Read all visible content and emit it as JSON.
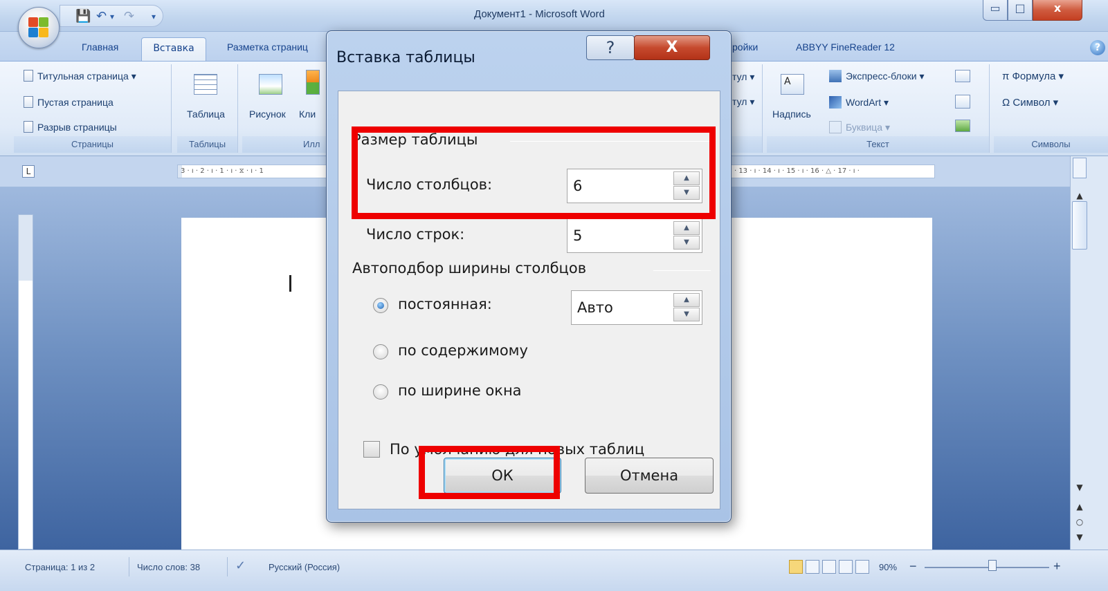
{
  "window": {
    "title": "Документ1 - Microsoft Word",
    "minimize_glyph": "▭",
    "maximize_glyph": "□",
    "close_glyph": "x"
  },
  "quick_access": {
    "save_icon": "💾",
    "undo_icon": "↶",
    "redo_icon": "↷",
    "customize_icon": "▾",
    "separator": "▾"
  },
  "tabs": [
    {
      "label": "Главная"
    },
    {
      "label": "Вставка"
    },
    {
      "label": "Разметка страниц"
    },
    {
      "label": "ройки"
    },
    {
      "label": "ABBYY FineReader 12"
    }
  ],
  "help_glyph": "?",
  "ribbon": {
    "pages_group": {
      "label": "Страницы",
      "items": [
        "Титульная страница ▾",
        "Пустая страница",
        "Разрыв страницы"
      ]
    },
    "tables_group": {
      "label": "Таблицы",
      "button": "Таблица"
    },
    "illustrations_group": {
      "label": "Илл",
      "button_picture": "Рисунок",
      "button_clip": "Кли"
    },
    "header_partial": {
      "item1": "тул ▾",
      "item2": "тул ▾"
    },
    "text_group": {
      "label": "Текст",
      "textbox": "Надпись",
      "items": [
        "Экспресс-блоки ▾",
        "WordArt ▾",
        "Буквица ▾"
      ]
    },
    "symbols_group": {
      "label": "Символы",
      "formula": "π Формула ▾",
      "symbol": "Ω Символ ▾"
    }
  },
  "ruler": {
    "corner": "L",
    "left_marks": "3 · ı · 2 · ı · 1 · ı · ⧖ · ı · 1",
    "right_marks": "ı · 13 · ı · 14 · ı · 15 · ı · 16 · △ · 17 · ı ·"
  },
  "dialog": {
    "title": "Вставка таблицы",
    "help_label": "?",
    "close_label": "X",
    "size_section": "Размер таблицы",
    "columns_label": "Число столбцов:",
    "columns_value": "6",
    "rows_label": "Число строк:",
    "rows_value": "5",
    "autofit_section": "Автоподбор ширины столбцов",
    "radio_fixed": "постоянная:",
    "fixed_value": "Авто",
    "radio_content": "по содержимому",
    "radio_window": "по ширине окна",
    "checkbox_default": "По умолчанию для новых таблиц",
    "ok": "ОК",
    "cancel": "Отмена",
    "spin_up": "▲",
    "spin_down": "▼"
  },
  "statusbar": {
    "page": "Страница: 1 из 2",
    "words": "Число слов: 38",
    "language": "Русский (Россия)",
    "zoom": "90%",
    "zoom_minus": "−",
    "zoom_plus": "+"
  },
  "scroll": {
    "up": "▲",
    "down": "▼",
    "prev": "▲",
    "select": "○",
    "next": "▼"
  },
  "colors": {
    "highlight": "#ee0000",
    "ribbon_blue": "#15428b"
  }
}
